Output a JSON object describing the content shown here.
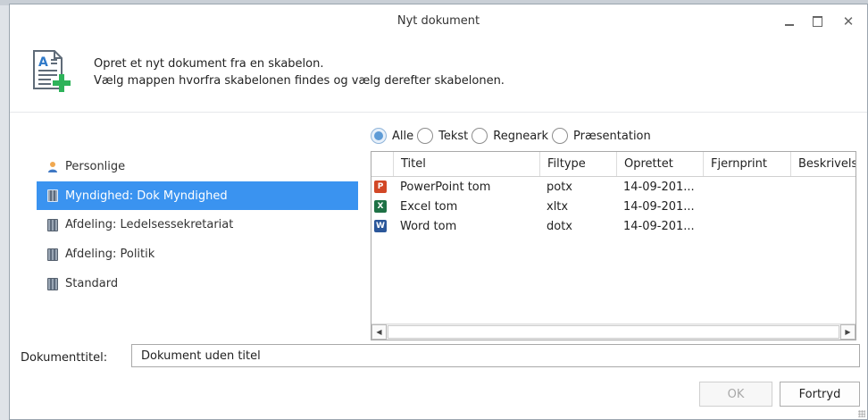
{
  "window": {
    "title": "Nyt dokument"
  },
  "intro": {
    "line1": "Opret et nyt dokument fra en skabelon.",
    "line2": "Vælg mappen hvorfra skabelonen findes og vælg derefter skabelonen."
  },
  "filters": [
    {
      "label": "Alle",
      "checked": true
    },
    {
      "label": "Tekst",
      "checked": false
    },
    {
      "label": "Regneark",
      "checked": false
    },
    {
      "label": "Præsentation",
      "checked": false
    }
  ],
  "folders": [
    {
      "label": "Personlige",
      "icon": "user-icon",
      "selected": false
    },
    {
      "label": "Myndighed: Dok Myndighed",
      "icon": "database-icon",
      "selected": true
    },
    {
      "label": "Afdeling: Ledelsessekretariat",
      "icon": "database-icon",
      "selected": false
    },
    {
      "label": "Afdeling: Politik",
      "icon": "database-icon",
      "selected": false
    },
    {
      "label": "Standard",
      "icon": "database-icon",
      "selected": false
    }
  ],
  "grid": {
    "columns": [
      "Titel",
      "Filtype",
      "Oprettet",
      "Fjernprint",
      "Beskrivelse"
    ],
    "rows": [
      {
        "icon": "powerpoint-icon",
        "title": "PowerPoint tom",
        "type": "potx",
        "created": "14-09-201...",
        "remote": "",
        "desc": ""
      },
      {
        "icon": "excel-icon",
        "title": "Excel tom",
        "type": "xltx",
        "created": "14-09-201...",
        "remote": "",
        "desc": ""
      },
      {
        "icon": "word-icon",
        "title": "Word tom",
        "type": "dotx",
        "created": "14-09-201...",
        "remote": "",
        "desc": ""
      }
    ]
  },
  "doc_title": {
    "label": "Dokumenttitel:",
    "value": "Dokument uden titel"
  },
  "buttons": {
    "ok": "OK",
    "cancel": "Fortryd"
  }
}
